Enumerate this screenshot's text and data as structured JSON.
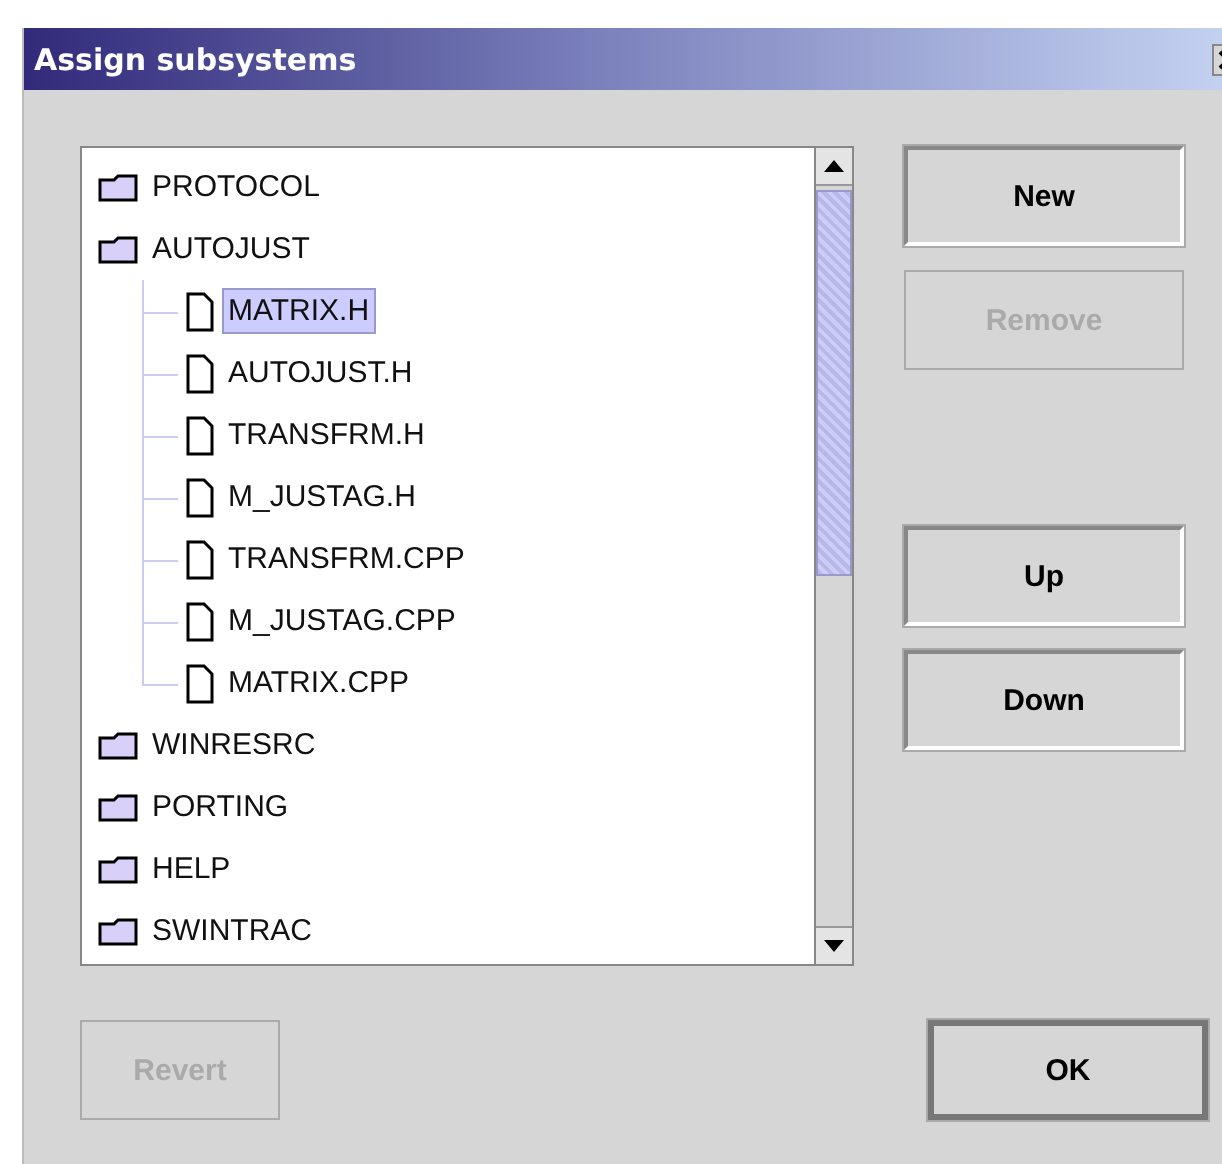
{
  "window": {
    "title": "Assign subsystems"
  },
  "tree": {
    "items": [
      {
        "label": "PROTOCOL",
        "kind": "folder",
        "selected": false
      },
      {
        "label": "AUTOJUST",
        "kind": "folder",
        "selected": false,
        "children": [
          {
            "label": "MATRIX.H",
            "kind": "file",
            "selected": true
          },
          {
            "label": "AUTOJUST.H",
            "kind": "file",
            "selected": false
          },
          {
            "label": "TRANSFRM.H",
            "kind": "file",
            "selected": false
          },
          {
            "label": "M_JUSTAG.H",
            "kind": "file",
            "selected": false
          },
          {
            "label": "TRANSFRM.CPP",
            "kind": "file",
            "selected": false
          },
          {
            "label": "M_JUSTAG.CPP",
            "kind": "file",
            "selected": false
          },
          {
            "label": "MATRIX.CPP",
            "kind": "file",
            "selected": false
          }
        ]
      },
      {
        "label": "WINRESRC",
        "kind": "folder",
        "selected": false
      },
      {
        "label": "PORTING",
        "kind": "folder",
        "selected": false
      },
      {
        "label": "HELP",
        "kind": "folder",
        "selected": false
      },
      {
        "label": "SWINTRAC",
        "kind": "folder",
        "selected": false
      }
    ]
  },
  "side_buttons": [
    {
      "label": "New",
      "disabled": false
    },
    {
      "label": "Remove",
      "disabled": true
    },
    {
      "label": "Up",
      "disabled": false
    },
    {
      "label": "Down",
      "disabled": false
    }
  ],
  "footer_buttons": [
    {
      "label": "Revert",
      "disabled": true,
      "default": false
    },
    {
      "label": "OK",
      "disabled": false,
      "default": true
    }
  ]
}
